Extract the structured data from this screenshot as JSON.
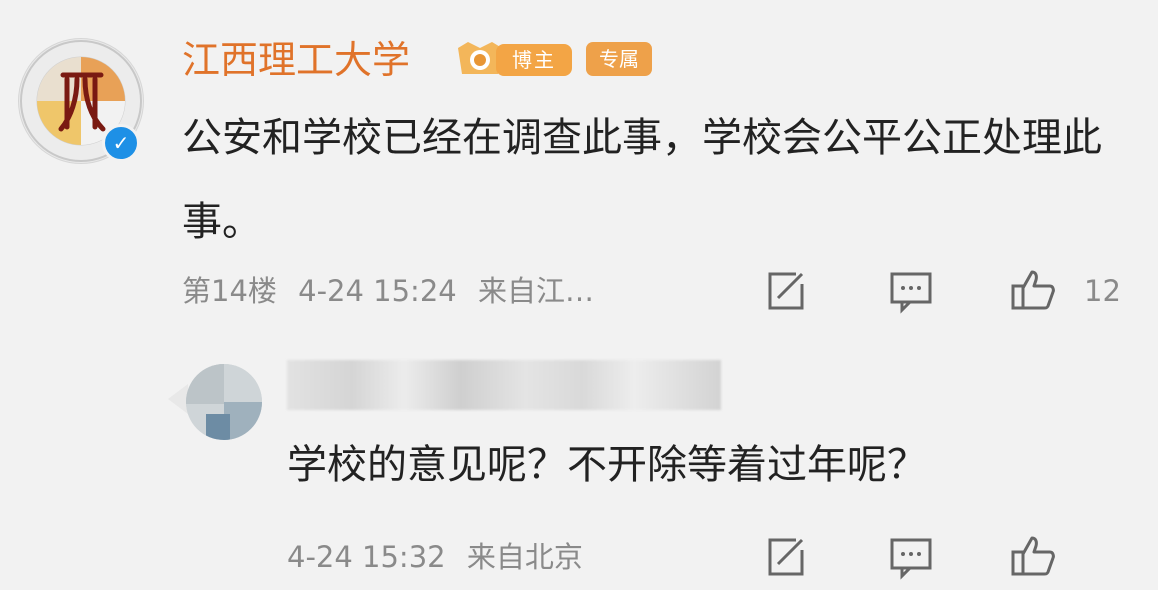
{
  "comment": {
    "username": "江西理工大学",
    "badge_blogger": "博主",
    "badge_column": "专属",
    "text": "公安和学校已经在调查此事，学校会公平公正处理此事。",
    "floor": "第14楼",
    "time": "4-24 15:24",
    "source": "来自江…",
    "like_count": "12"
  },
  "reply": {
    "text": "学校的意见呢？不开除等着过年呢？",
    "time": "4-24 15:32",
    "source": "来自北京"
  },
  "colors": {
    "username": "#e0732a",
    "badge": "#f3a545",
    "verified": "#1e90e6",
    "meta": "#8a8a8a"
  },
  "icons": [
    "share-icon",
    "comment-icon",
    "like-icon",
    "verified-icon"
  ]
}
